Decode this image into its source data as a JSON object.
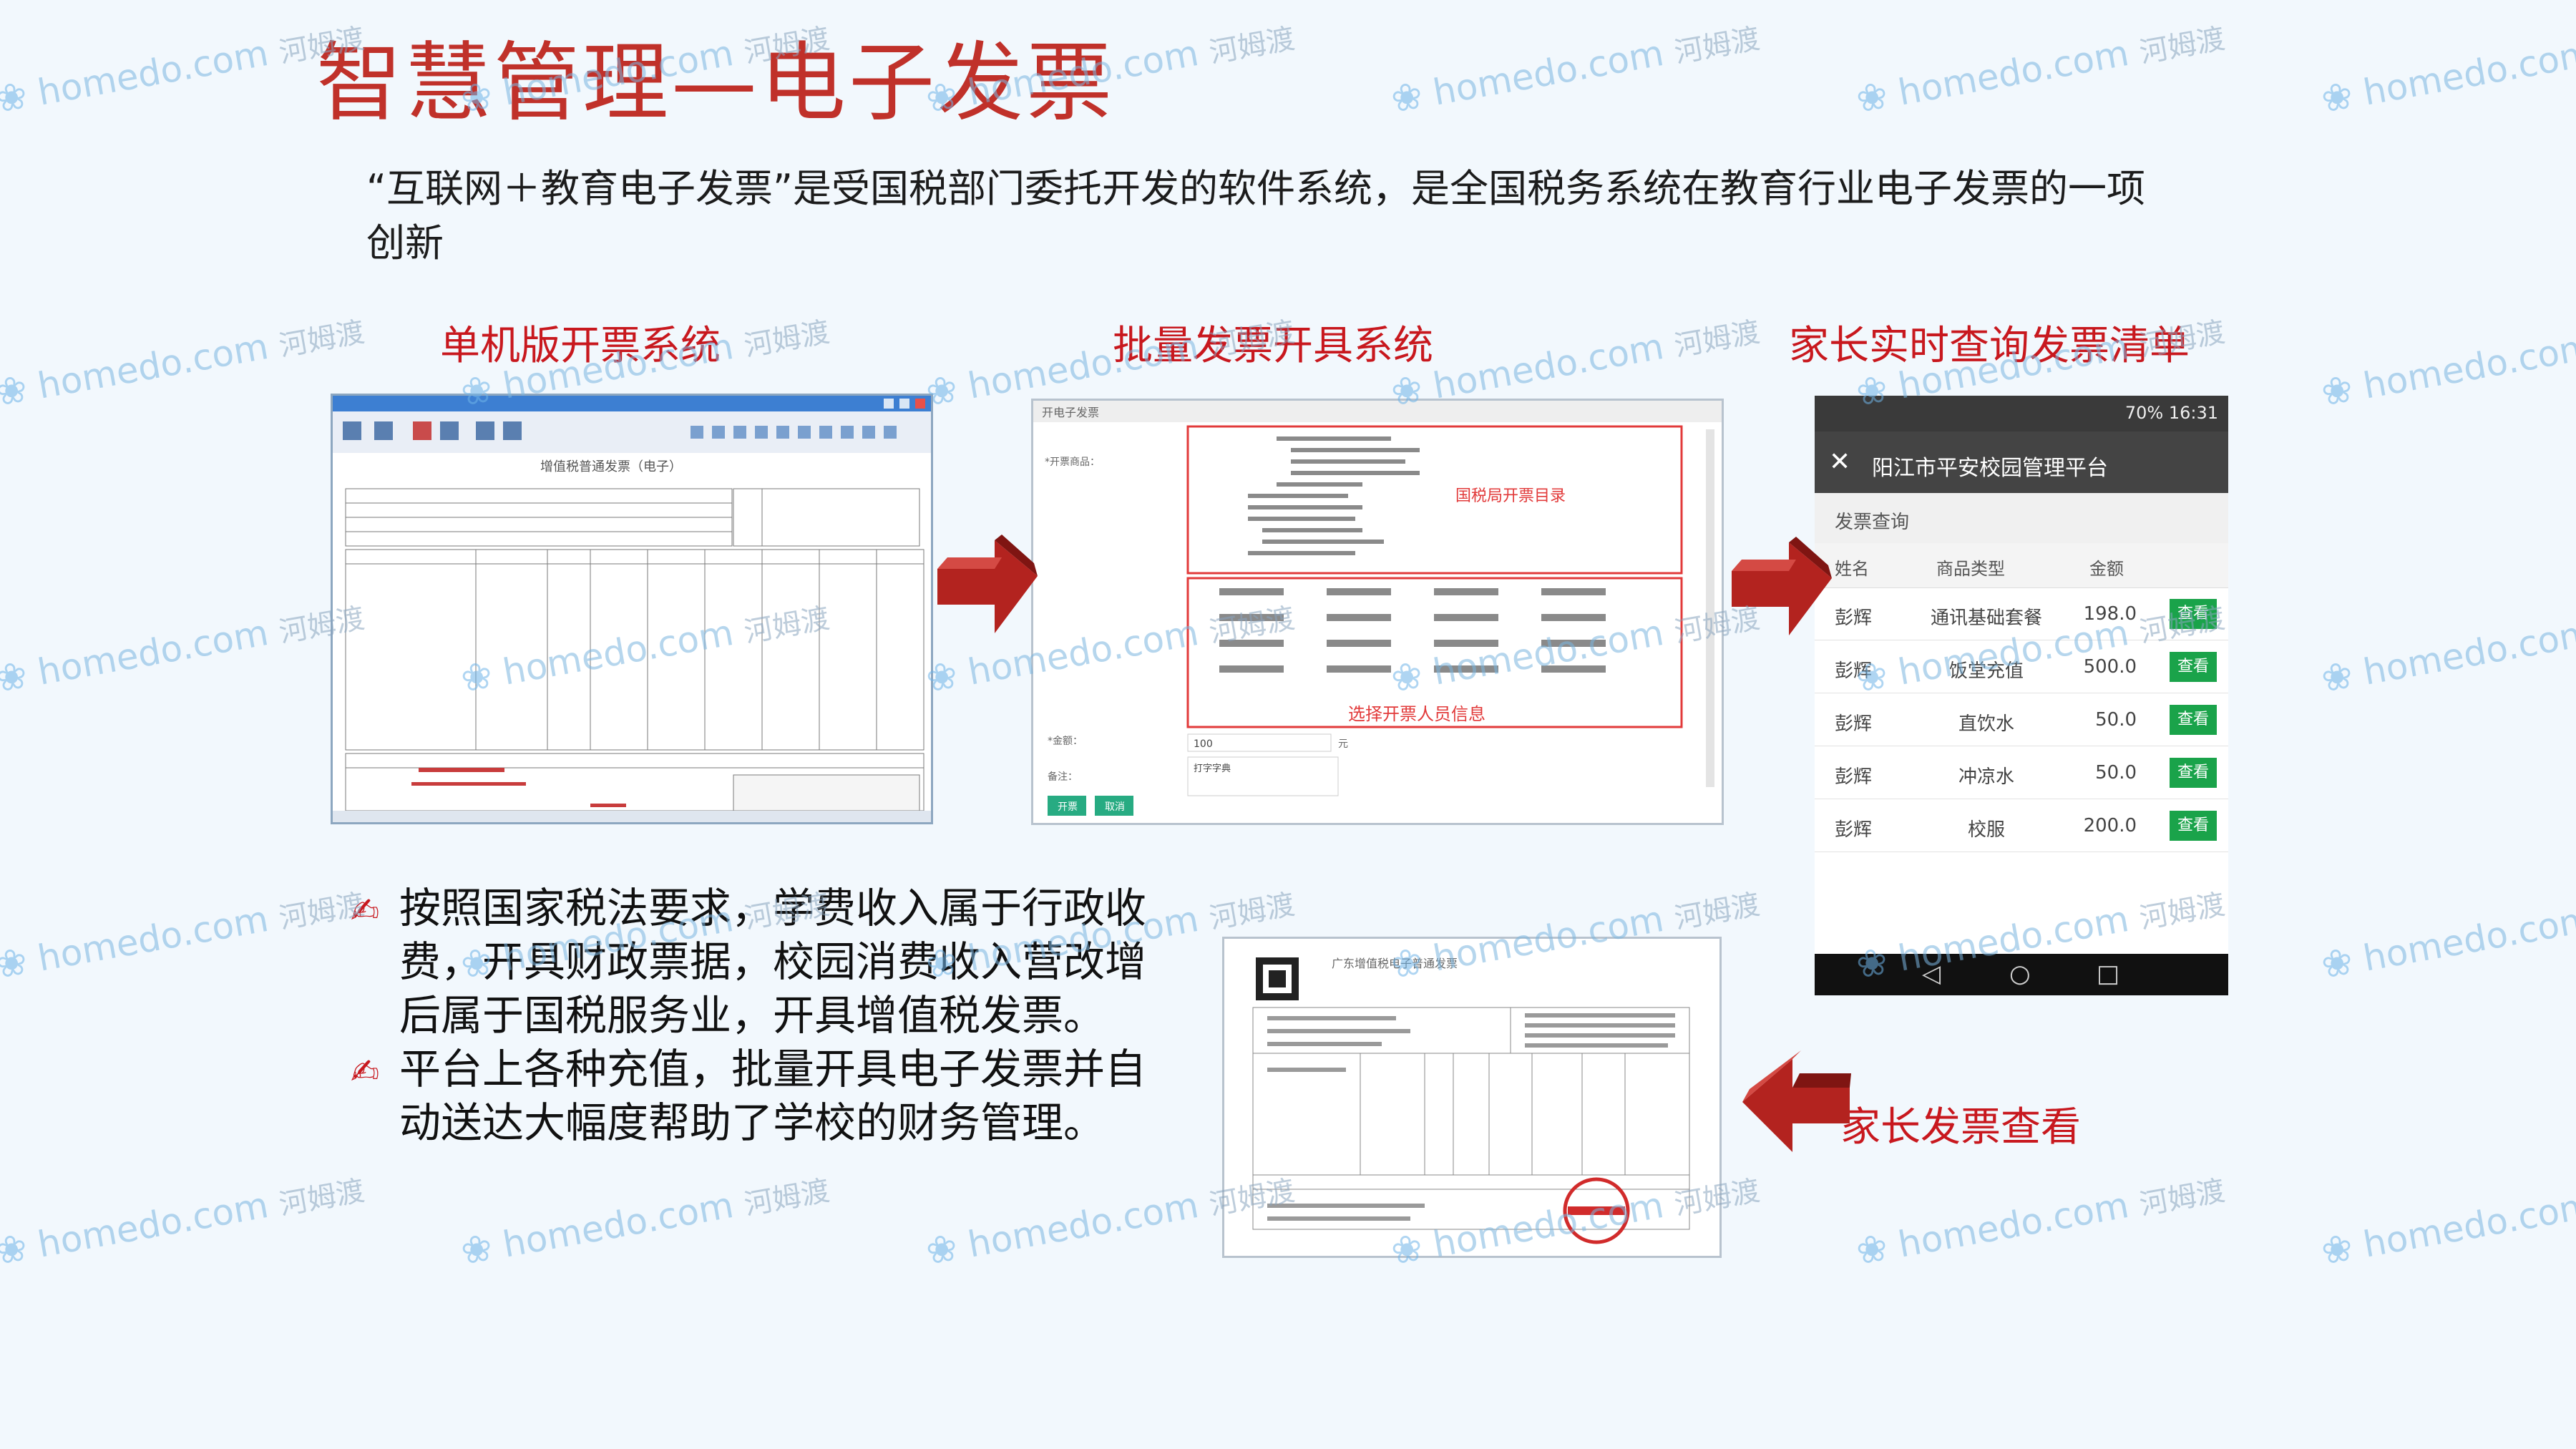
{
  "title": "智慧管理—电子发票",
  "intro": "“互联网＋教育电子发票”是受国税部门委托开发的软件系统，是全国税务系统在教育行业电子发票的一项创新",
  "sections": {
    "standalone": "单机版开票系统",
    "batch": "批量发票开具系统",
    "parent_query": "家长实时查询发票清单",
    "parent_view": "家长发票查看"
  },
  "standalone_window": {
    "title": "增值税普通发票（电子）"
  },
  "batch_window": {
    "header": "开电子发票",
    "label_goods": "*开票商品：",
    "catalog_note": "国税局开票目录",
    "people_note": "选择开票人员信息",
    "label_amount": "*金额：",
    "amount_value": "100",
    "unit": "元",
    "label_remark": "备注：",
    "remark_value": "打字字典",
    "btn_issue": "开票",
    "btn_cancel": "取消"
  },
  "phone": {
    "status": "70% 16:31",
    "app_title": "阳江市平安校园管理平台",
    "section_title": "发票查询",
    "columns": [
      "姓名",
      "商品类型",
      "金额"
    ],
    "rows": [
      {
        "name": "彭辉",
        "type": "通讯基础套餐",
        "amount": "198.0",
        "action": "查看"
      },
      {
        "name": "彭辉",
        "type": "饭堂充值",
        "amount": "500.0",
        "action": "查看"
      },
      {
        "name": "彭辉",
        "type": "直饮水",
        "amount": "50.0",
        "action": "查看"
      },
      {
        "name": "彭辉",
        "type": "冲凉水",
        "amount": "50.0",
        "action": "查看"
      },
      {
        "name": "彭辉",
        "type": "校服",
        "amount": "200.0",
        "action": "查看"
      }
    ]
  },
  "invoice": {
    "title": "广东增值税电子普通发票"
  },
  "bullets": [
    "按照国家税法要求，学费收入属于行政收费，开具财政票据，校园消费收入营改增后属于国税服务业，开具增值税发票。",
    "平台上各种充值，批量开具电子发票并自动送达大幅度帮助了学校的财务管理。"
  ],
  "watermark": {
    "latin": "homedo.com",
    "chinese": "河姆渡"
  },
  "colors": {
    "title_red": "#c0312a",
    "section_red": "#c8181e",
    "arrow_red": "#b3231f",
    "phone_green": "#1aa34a"
  }
}
